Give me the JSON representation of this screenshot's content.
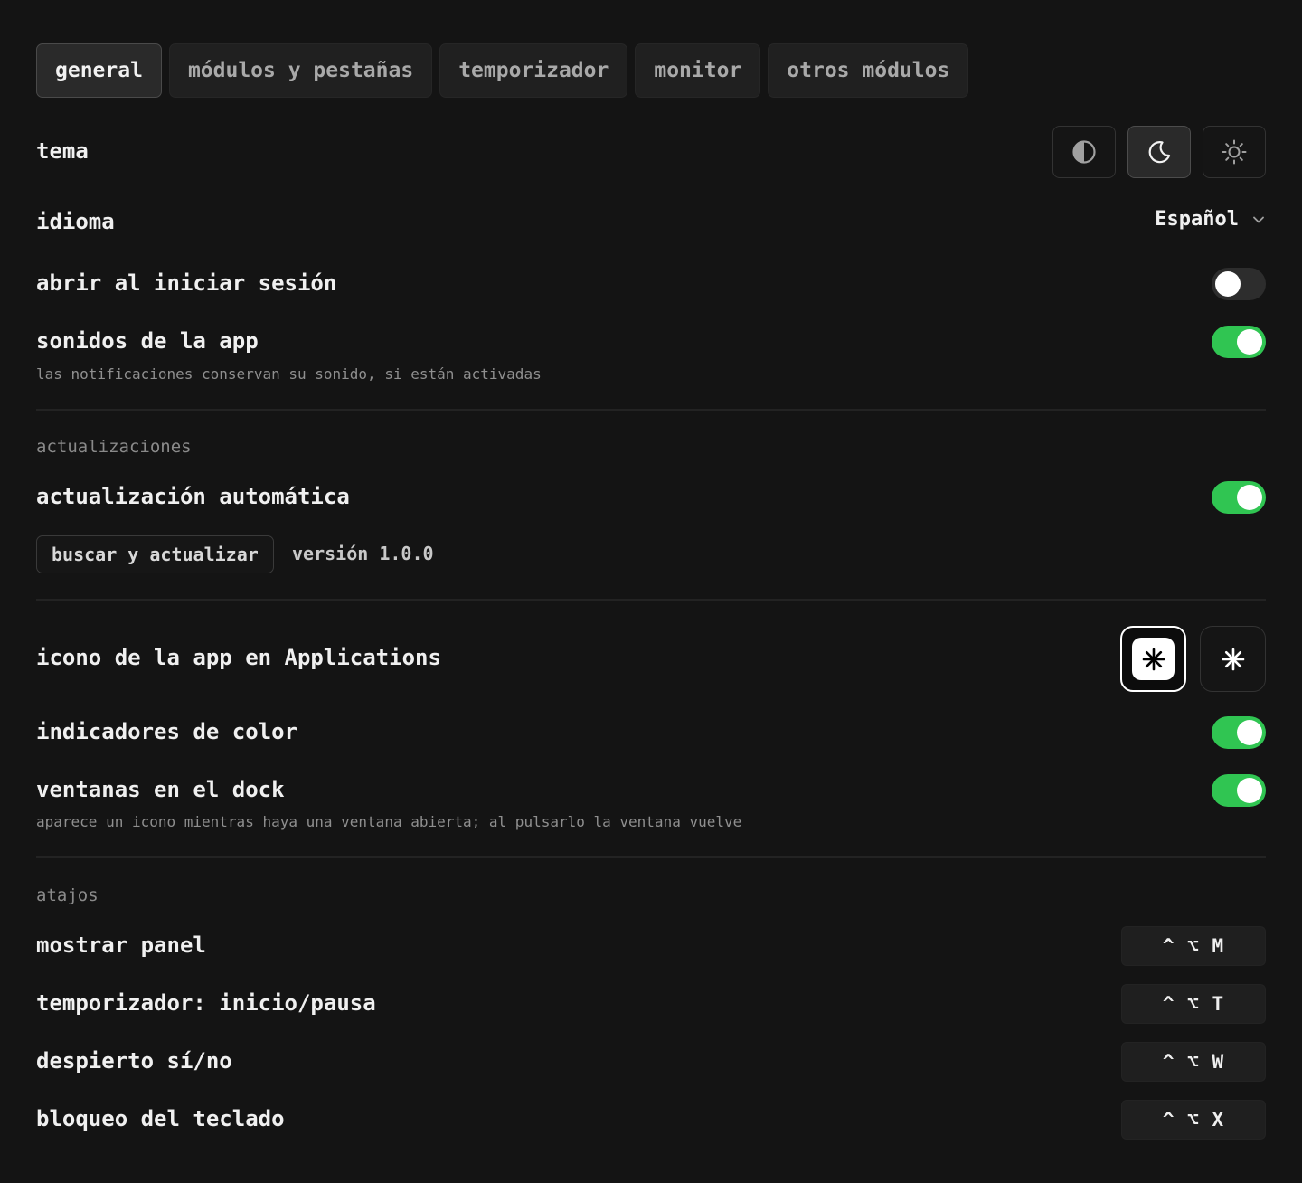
{
  "tabs": [
    {
      "label": "general",
      "active": true
    },
    {
      "label": "módulos y pestañas",
      "active": false
    },
    {
      "label": "temporizador",
      "active": false
    },
    {
      "label": "monitor",
      "active": false
    },
    {
      "label": "otros módulos",
      "active": false
    }
  ],
  "general": {
    "theme": {
      "label": "tema",
      "options": [
        {
          "icon": "half-circle-icon",
          "selected": false
        },
        {
          "icon": "moon-icon",
          "selected": true
        },
        {
          "icon": "sun-icon",
          "selected": false
        }
      ]
    },
    "language": {
      "label": "idioma",
      "value": "Español",
      "icon": "chevron-down-icon"
    },
    "open_at_login": {
      "label": "abrir al iniciar sesión",
      "enabled": false
    },
    "app_sounds": {
      "label": "sonidos de la app",
      "description": "las notificaciones conservan su sonido, si están activadas",
      "enabled": true
    }
  },
  "updates": {
    "section_title": "actualizaciones",
    "auto_update": {
      "label": "actualización automática",
      "enabled": true
    },
    "check_button": "buscar y actualizar",
    "version": "versión 1.0.0"
  },
  "appearance": {
    "app_icon": {
      "label": "icono de la app en Applications",
      "options": [
        "light-asterisk-icon",
        "dark-asterisk-icon"
      ],
      "selected_index": 0
    },
    "color_indicators": {
      "label": "indicadores de color",
      "enabled": true
    },
    "dock_windows": {
      "label": "ventanas en el dock",
      "description": "aparece un icono mientras haya una ventana abierta; al pulsarlo la ventana vuelve",
      "enabled": true
    }
  },
  "shortcuts": {
    "section_title": "atajos",
    "items": [
      {
        "label": "mostrar panel",
        "keys": "^ ⌥ M"
      },
      {
        "label": "temporizador: inicio/pausa",
        "keys": "^ ⌥ T"
      },
      {
        "label": "despierto sí/no",
        "keys": "^ ⌥ W"
      },
      {
        "label": "bloqueo del teclado",
        "keys": "^ ⌥ X"
      }
    ]
  },
  "colors": {
    "background": "#141414",
    "toggle_on": "#30c552",
    "toggle_off": "#2d2d2d"
  }
}
